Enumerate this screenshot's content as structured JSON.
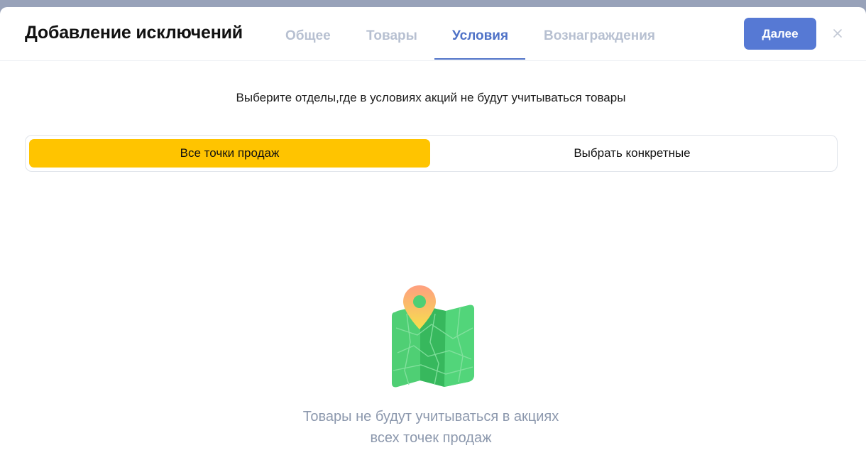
{
  "modal": {
    "title": "Добавление исключений",
    "tabs": [
      {
        "label": "Общее",
        "active": false
      },
      {
        "label": "Товары",
        "active": false
      },
      {
        "label": "Условия",
        "active": true
      },
      {
        "label": "Вознаграждения",
        "active": false
      }
    ],
    "next_label": "Далее",
    "close_icon": "close-icon"
  },
  "content": {
    "instruction": "Выберите отделы,где в условиях акций не будут учитываться товары",
    "options": [
      {
        "label": "Все точки продаж",
        "selected": true
      },
      {
        "label": "Выбрать конкретные",
        "selected": false
      }
    ],
    "empty_state": {
      "icon": "map-pin-icon",
      "text": "Товары не будут учитываться в акциях всех точек продаж"
    }
  },
  "colors": {
    "accent": "#4f72c7",
    "button": "#5679d4",
    "selected_option": "#ffc400",
    "inactive_tab": "#b7c0d1",
    "muted_text": "#8c98ad"
  }
}
